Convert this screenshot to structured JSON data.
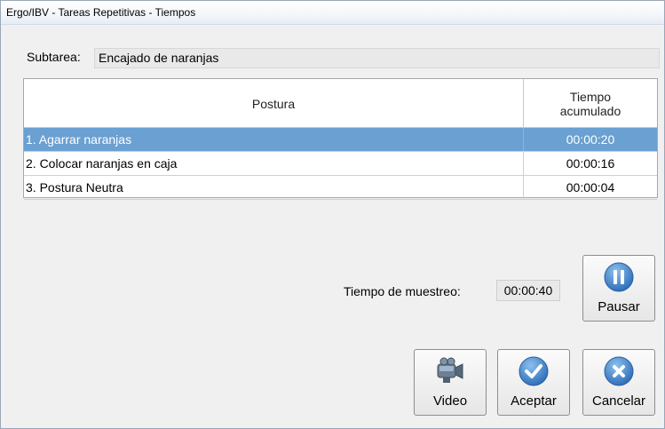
{
  "window": {
    "title": "Ergo/IBV - Tareas Repetitivas - Tiempos"
  },
  "subtarea": {
    "label": "Subtarea:",
    "value": "Encajado de naranjas"
  },
  "table": {
    "headers": {
      "postura": "Postura",
      "tiempo": "Tiempo\nacumulado"
    },
    "rows": [
      {
        "postura": "1. Agarrar naranjas",
        "tiempo": "00:00:20",
        "selected": true
      },
      {
        "postura": "2. Colocar naranjas en caja",
        "tiempo": "00:00:16",
        "selected": false
      },
      {
        "postura": "3. Postura Neutra",
        "tiempo": "00:00:04",
        "selected": false
      }
    ]
  },
  "muestreo": {
    "label": "Tiempo de muestreo:",
    "value": "00:00:40"
  },
  "buttons": {
    "pausar": {
      "label": "Pausar",
      "icon": "pause-icon"
    },
    "video": {
      "label": "Video",
      "icon": "video-camera-icon"
    },
    "aceptar": {
      "label": "Aceptar",
      "icon": "checkmark-icon"
    },
    "cancelar": {
      "label": "Cancelar",
      "icon": "close-icon"
    }
  },
  "colors": {
    "selection": "#6aa0d2",
    "icon_blue": "#3a7fc8"
  }
}
